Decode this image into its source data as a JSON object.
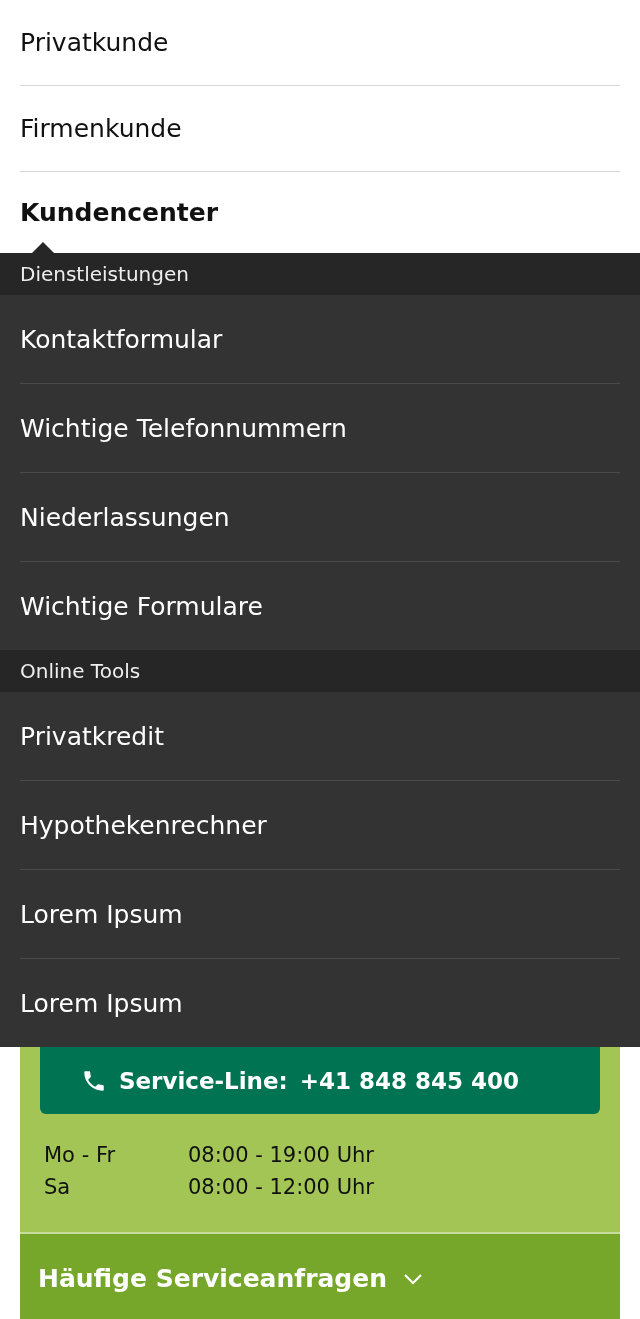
{
  "nav": [
    {
      "label": "Privatkunde",
      "selected": false
    },
    {
      "label": "Firmenkunde",
      "selected": false
    },
    {
      "label": "Kundencenter",
      "selected": true
    }
  ],
  "menu": [
    {
      "title": "Dienstleistungen",
      "items": [
        "Kontaktformular",
        "Wichtige Telefonnummern",
        "Niederlassungen",
        "Wichtige Formulare"
      ]
    },
    {
      "title": "Online Tools",
      "items": [
        "Privatkredit",
        "Hypothekenrechner",
        "Lorem Ipsum",
        "Lorem Ipsum"
      ]
    }
  ],
  "service": {
    "label": "Service-Line:",
    "phone": "+41 848 845 400",
    "hours": [
      {
        "days": "Mo - Fr",
        "time": "08:00 - 19:00 Uhr"
      },
      {
        "days": "Sa",
        "time": "08:00 - 12:00 Uhr"
      }
    ]
  },
  "faq": {
    "label": "Häufige Serviceanfragen",
    "expanded": false
  }
}
